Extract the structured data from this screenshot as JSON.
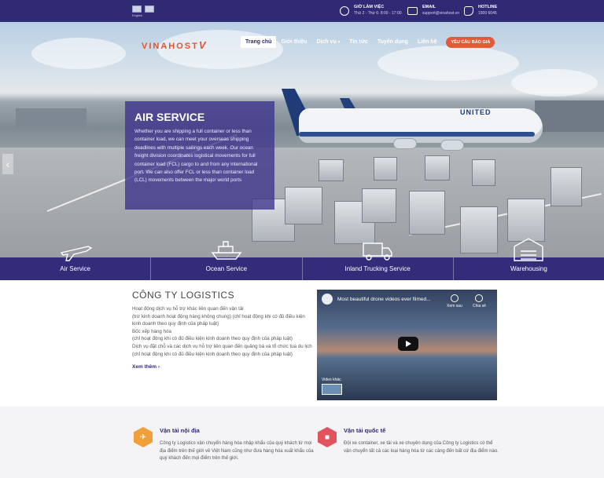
{
  "topbar": {
    "flag_label": "English",
    "hours": {
      "title": "GIỜ LÀM VIỆC",
      "value": "Thứ 2 - Thứ 6: 8:00 - 17:00"
    },
    "email": {
      "title": "EMAIL",
      "value": "support@vinahost.vn"
    },
    "hotline": {
      "title": "HOTLINE",
      "value": "1900 6046"
    }
  },
  "brand": {
    "logo_text": "VINAHOST",
    "logo_mark": "V"
  },
  "nav": {
    "items": [
      "Trang chủ",
      "Giới thiệu",
      "Dịch vụ",
      "Tin tức",
      "Tuyển dụng",
      "Liên hệ"
    ],
    "cta": "YÊU CẦU BÁO GIÁ",
    "active_color": "#2f2a73",
    "cta_color": "#e05b3a"
  },
  "hero": {
    "plane_brand": "UNITED",
    "title": "AIR SERVICE",
    "text": "Whether you are shipping a full container or less than container load, we can meet your overseas shipping deadlines with multiple sailings each week. Our ocean freight division coordinates logistical movements for full container load (FCL) cargo to and from any international port. We can also offer FCL or less than container load (LCL) movements between the major world ports",
    "arrow": "‹"
  },
  "services": [
    {
      "label": "Air Service",
      "icon": "airplane-icon"
    },
    {
      "label": "Ocean Service",
      "icon": "ship-icon"
    },
    {
      "label": "Inland Trucking Service",
      "icon": "truck-icon"
    },
    {
      "label": "Warehousing",
      "icon": "warehouse-icon"
    }
  ],
  "company": {
    "title": "CÔNG TY LOGISTICS",
    "lines": [
      "Hoạt động dịch vụ hỗ trợ khác liên quan đến vận tải",
      "(trừ kinh doanh hoạt động hàng không chung) (chỉ hoạt động khi có đủ điều kiện kinh doanh theo quy định của pháp luật)",
      "Bốc xếp hàng hóa",
      "(chỉ hoạt động khi có đủ điều kiện kinh doanh theo quy định của pháp luật)",
      "Dịch vụ đặt chỗ và các dịch vụ hỗ trợ liên quan đến quảng bá và tổ chức tua du lịch",
      "(chỉ hoạt động khi có đủ điều kiện kinh doanh theo quy định của pháp luật)"
    ],
    "more": "Xem thêm ›"
  },
  "video": {
    "title": "Most beautiful drone videos ever filmed...",
    "watch_later": "Xem sau",
    "share": "Chia sẻ",
    "more_videos": "Video khác"
  },
  "features": [
    {
      "title": "Vận tải nội địa",
      "text": "Công ty Logistics vận chuyển hàng hóa nhập khẩu của quý khách từ mọi địa điểm trên thế giới về Việt Nam cũng như đưa hàng hóa xuất khẩu của quý khách đến mọi điểm trên thế giới.",
      "color": "#f0a03a",
      "icon": "airplane-icon"
    },
    {
      "title": "Vận tải quốc tế",
      "text": "Đội xe container, xe tải và xe chuyên dụng của Công ty Logistics có thể vận chuyển tất cả các loại hàng hóa từ các cảng đến bất cứ địa điểm nào.",
      "color": "#e0535f",
      "icon": "truck-icon"
    }
  ]
}
